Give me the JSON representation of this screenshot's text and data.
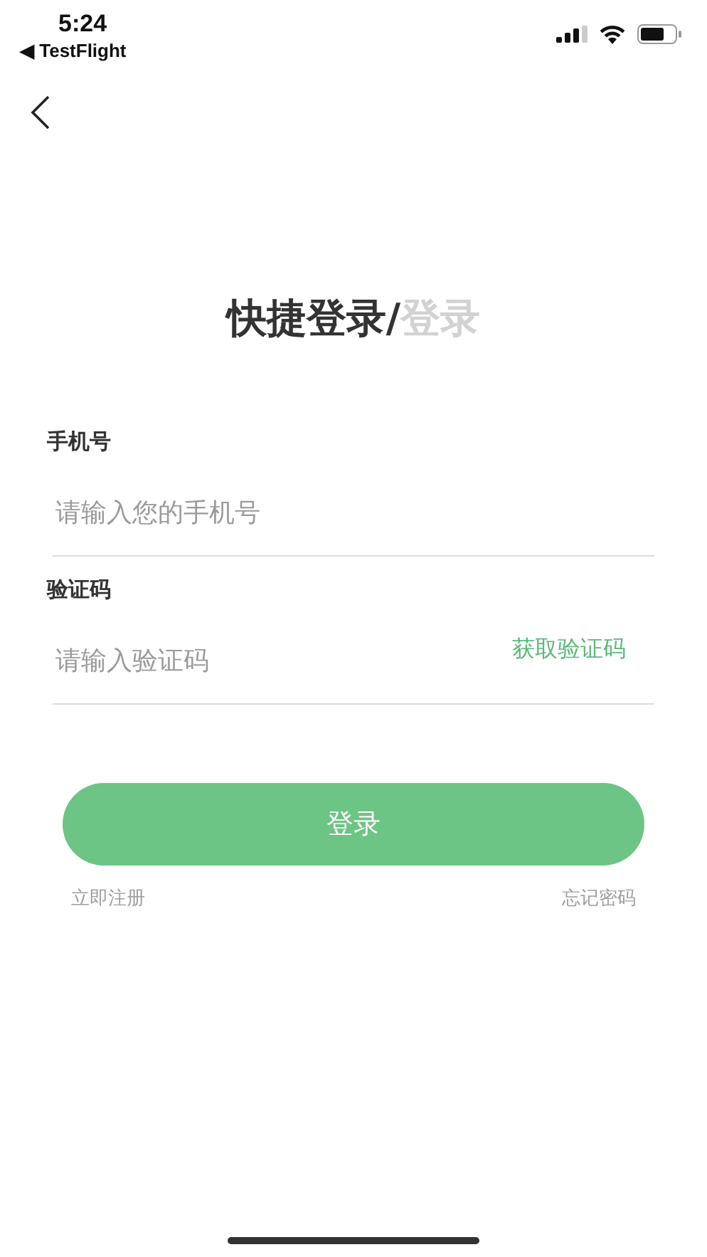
{
  "status_bar": {
    "time": "5:24",
    "back_app": "◀ TestFlight"
  },
  "title_tabs": [
    {
      "label": "快捷登录",
      "selected": true
    },
    {
      "label": "登录",
      "selected": false
    }
  ],
  "title_separator": "/",
  "fields": [
    {
      "label": "手机号",
      "placeholder": "请输入您的手机号"
    },
    {
      "label": "验证码",
      "placeholder": "请输入验证码",
      "action": "获取验证码"
    }
  ],
  "login_button": "登录",
  "links": [
    "立即注册",
    "忘记密码"
  ]
}
